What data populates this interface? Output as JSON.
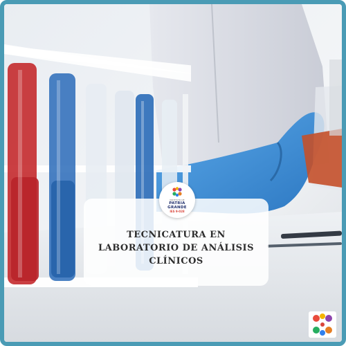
{
  "course": {
    "title_lines": [
      "TECNICATURA EN",
      "LABORATORIO DE ANÁLISIS",
      "CLÍNICOS"
    ]
  },
  "institution": {
    "top_text": "INSTITUTO DE",
    "name_lines": [
      "PATRIA",
      "GRANDE"
    ],
    "code": "IES 9-028"
  },
  "colors": {
    "frame": "#4a9bb5",
    "glove": "#3b8fd6",
    "tube_red": "#c42a2e",
    "tube_blue": "#2a6bb8",
    "logo_dots": [
      "#e94b3c",
      "#f4b400",
      "#8e44ad",
      "#27ae60",
      "#2f80ed",
      "#e67e22"
    ]
  },
  "icons": {
    "badge": "institution-logo-icon",
    "corner": "dots-logo-icon"
  }
}
